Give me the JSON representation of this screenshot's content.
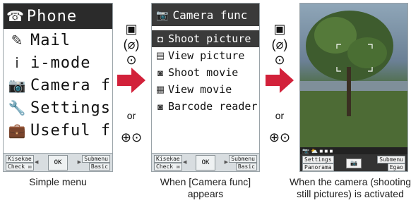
{
  "screen1": {
    "title": "Phone",
    "items": [
      {
        "label": "Mail",
        "icon": "mail-icon"
      },
      {
        "label": "i-mode",
        "icon": "imode-icon"
      },
      {
        "label": "Camera f",
        "icon": "camera-icon"
      },
      {
        "label": "Settings",
        "icon": "settings-icon"
      },
      {
        "label": "Useful f",
        "icon": "briefcase-icon"
      }
    ],
    "softkeys": {
      "top_left": "Kisekae",
      "bottom_left": "Check ✉",
      "center": "OK",
      "top_right": "Submenu",
      "bottom_right": "Basic"
    },
    "caption": "Simple menu"
  },
  "screen2": {
    "title": "Camera func",
    "items": [
      {
        "label": "Shoot picture",
        "selected": true
      },
      {
        "label": "View picture",
        "selected": false
      },
      {
        "label": "Shoot movie",
        "selected": false
      },
      {
        "label": "View movie",
        "selected": false
      },
      {
        "label": "Barcode reader",
        "selected": false
      }
    ],
    "softkeys": {
      "top_left": "Kisekae",
      "bottom_left": "Check ✉",
      "center": "OK",
      "top_right": "Submenu",
      "bottom_right": "Basic"
    },
    "caption": "When [Camera func] appears"
  },
  "screen3": {
    "status_text": "📷 ⛅ ■ ■ ■",
    "softkeys": {
      "top_left": "Settings",
      "bottom_left": "Panorama",
      "center": "📷",
      "top_right": "Submenu",
      "bottom_right": "Egao"
    },
    "caption": "When the camera (shooting still pictures) is activated"
  },
  "controls": {
    "key1": "▣",
    "key2": "(⌀)",
    "key3": "⊙",
    "or": "or",
    "nav_keys": "⊕⊙"
  },
  "colors": {
    "arrow": "#d2213a",
    "header": "#2b2b2b"
  }
}
